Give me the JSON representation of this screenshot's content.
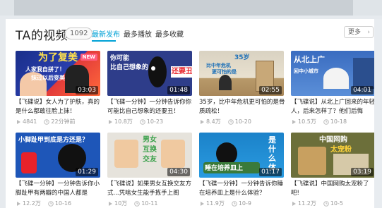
{
  "header": {
    "title": "TA的视频",
    "count": "1092",
    "tabs": [
      {
        "label": "最新发布",
        "active": true
      },
      {
        "label": "最多播放",
        "active": false
      },
      {
        "label": "最多收藏",
        "active": false
      }
    ],
    "more_label": "更多",
    "more_icon": "chevron-right-icon"
  },
  "colors": {
    "accent": "#00a1d6",
    "new_badge": "#ff5c7c"
  },
  "videos": [
    {
      "thumb_text": [
        "为了复美",
        "人家我自拼了！",
        "抹过以后变美"
      ],
      "badge": "NEW",
      "duration": "03:03",
      "title": "【飞碟说】女人为了护肤，真的是什么都敢往脸上抹！",
      "plays": "4841",
      "comments": "22分钟前"
    },
    {
      "thumb_text": [
        "你可能",
        "比自己想象的",
        "还要丑！"
      ],
      "duration": "01:48",
      "title": "【飞碟一分钟】一分钟告诉你你可能比自己想象的还要丑！",
      "plays": "10.8万",
      "comments": "10-23"
    },
    {
      "thumb_text": [
        "35岁",
        "比中年危机",
        "更可怕的是"
      ],
      "duration": "02:55",
      "title": "35岁，比中年危机更可怕的是骨质疏松！",
      "plays": "8.4万",
      "comments": "10-20"
    },
    {
      "thumb_text": [
        "从北上广",
        "回中小城市"
      ],
      "duration": "04:01",
      "title": "【飞碟说】从北上广回来的年轻人，后来怎样了？他们后悔",
      "plays": "10.5万",
      "comments": "10-18"
    },
    {
      "thumb_text": [
        "小脚趾甲到底是方还是？"
      ],
      "duration": "01:29",
      "title": "【飞碟一分钟】一分钟告诉你小脚趾甲有两瓣的中国人都是",
      "plays": "12.2万",
      "comments": "10-16"
    },
    {
      "thumb_text": [
        "男女",
        "互换",
        "交友"
      ],
      "duration": "04:30",
      "title": "【飞碟说】如果男女互换交友方式...凭啥女生能手拣手上阁",
      "plays": "10万",
      "comments": "10-11"
    },
    {
      "thumb_text": [
        "睡在培养皿上"
      ],
      "duration": "01:17",
      "title": "【飞碟一分钟】一分钟告诉你睡在培养皿上是什么体验？",
      "plays": "11.9万",
      "comments": "10-9"
    },
    {
      "thumb_text": [
        "中国网购",
        "太宠粉"
      ],
      "duration": "03:19",
      "title": "【飞碟说】中国网购太宠粉了吧!",
      "plays": "11.2万",
      "comments": "10-5"
    }
  ]
}
